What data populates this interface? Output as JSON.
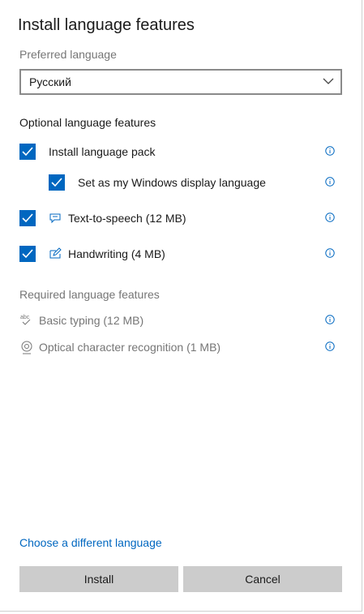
{
  "dialog": {
    "title": "Install language features",
    "preferred_label": "Preferred language",
    "selected_language": "Русский",
    "optional_label": "Optional language features",
    "optional_items": [
      {
        "label": "Install language pack",
        "checked": true
      },
      {
        "label": "Set as my Windows display language",
        "checked": true
      },
      {
        "label": "Text-to-speech (12 MB)",
        "checked": true,
        "icon": "speech-icon"
      },
      {
        "label": "Handwriting (4 MB)",
        "checked": true,
        "icon": "pen-icon"
      }
    ],
    "required_label": "Required language features",
    "required_items": [
      {
        "label": "Basic typing (12 MB)",
        "icon": "abc-check-icon"
      },
      {
        "label": "Optical character recognition (1 MB)",
        "icon": "ocr-icon"
      }
    ],
    "change_link": "Choose a different language",
    "install_button": "Install",
    "cancel_button": "Cancel"
  },
  "colors": {
    "accent": "#0067c0",
    "muted_text": "#767676",
    "button_bg": "#cccccc"
  }
}
